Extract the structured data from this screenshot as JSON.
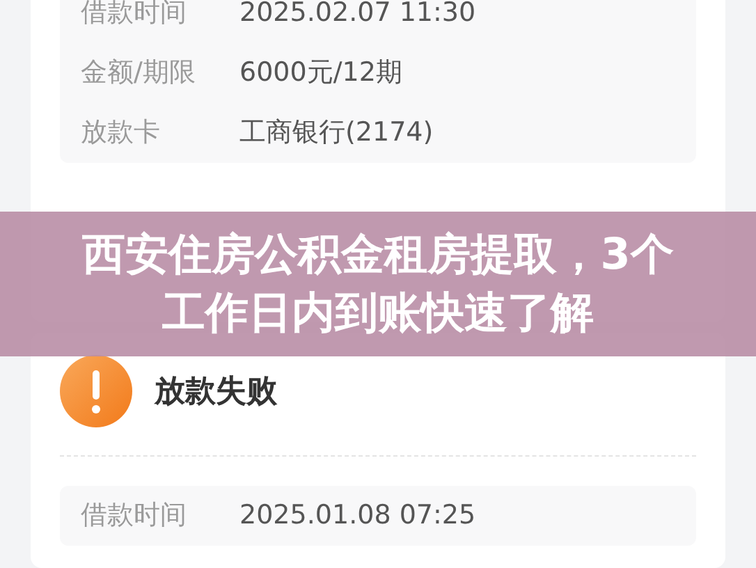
{
  "cards": [
    {
      "details": [
        {
          "label": "借款时间",
          "value": "2025.02.07 11:30"
        },
        {
          "label": "金额/期限",
          "value": "6000元/12期"
        },
        {
          "label": "放款卡",
          "value": "工商银行(2174)"
        }
      ]
    },
    {
      "status_title": "放款失败",
      "details": [
        {
          "label": "借款时间",
          "value": "2025.01.08 07:25"
        }
      ]
    }
  ],
  "banner": {
    "title": "西安住房公积金租房提取，3个工作日内到账快速了解"
  }
}
